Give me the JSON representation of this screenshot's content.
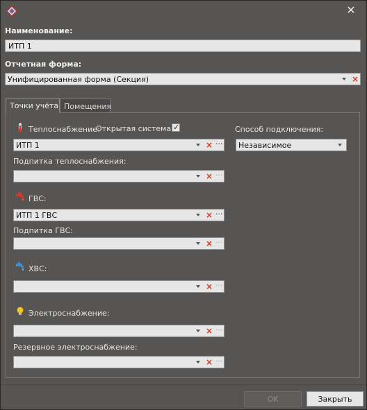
{
  "dialog": {
    "name_label": "Наименование:",
    "name_value": "ИТП 1",
    "report_form_label": "Отчетная форма:",
    "report_form_value": "Унифицированная форма (Секция)"
  },
  "tabs": [
    {
      "label": "Точки учёта",
      "active": true
    },
    {
      "label": "Помещения",
      "active": false
    }
  ],
  "metering": {
    "heating_label": "Теплоснабжение:",
    "open_system_label": "Открытая система:",
    "open_system_checked": true,
    "heating_value": "ИТП 1",
    "heating_feed_label": "Подпитка теплоснабжения:",
    "heating_feed_value": "",
    "connection_label": "Способ подключения:",
    "connection_value": "Независимое",
    "hot_water_label": "ГВС:",
    "hot_water_value": "ИТП 1 ГВС",
    "hot_water_feed_label": "Подпитка ГВС:",
    "hot_water_feed_value": "",
    "cold_water_label": "ХВС:",
    "cold_water_value": "",
    "electricity_label": "Электроснабжение:",
    "electricity_value": "",
    "reserve_electricity_label": "Резервное электроснабжение:",
    "reserve_electricity_value": ""
  },
  "buttons": {
    "ok_label": "OK",
    "close_label": "Закрыть"
  },
  "icons": {
    "app": "app-diamond-icon",
    "close": "close-icon",
    "heating": "thermometer-icon",
    "hot_water": "hot-water-tap-icon",
    "cold_water": "cold-water-tap-icon",
    "electricity": "lightbulb-icon",
    "clear": "clear-x-icon",
    "browse": "ellipsis-icon",
    "dropdown": "chevron-down-icon"
  },
  "colors": {
    "window_bg": "#575553",
    "clear_red": "#d2381e",
    "field_bg": "#e6e6e6"
  }
}
